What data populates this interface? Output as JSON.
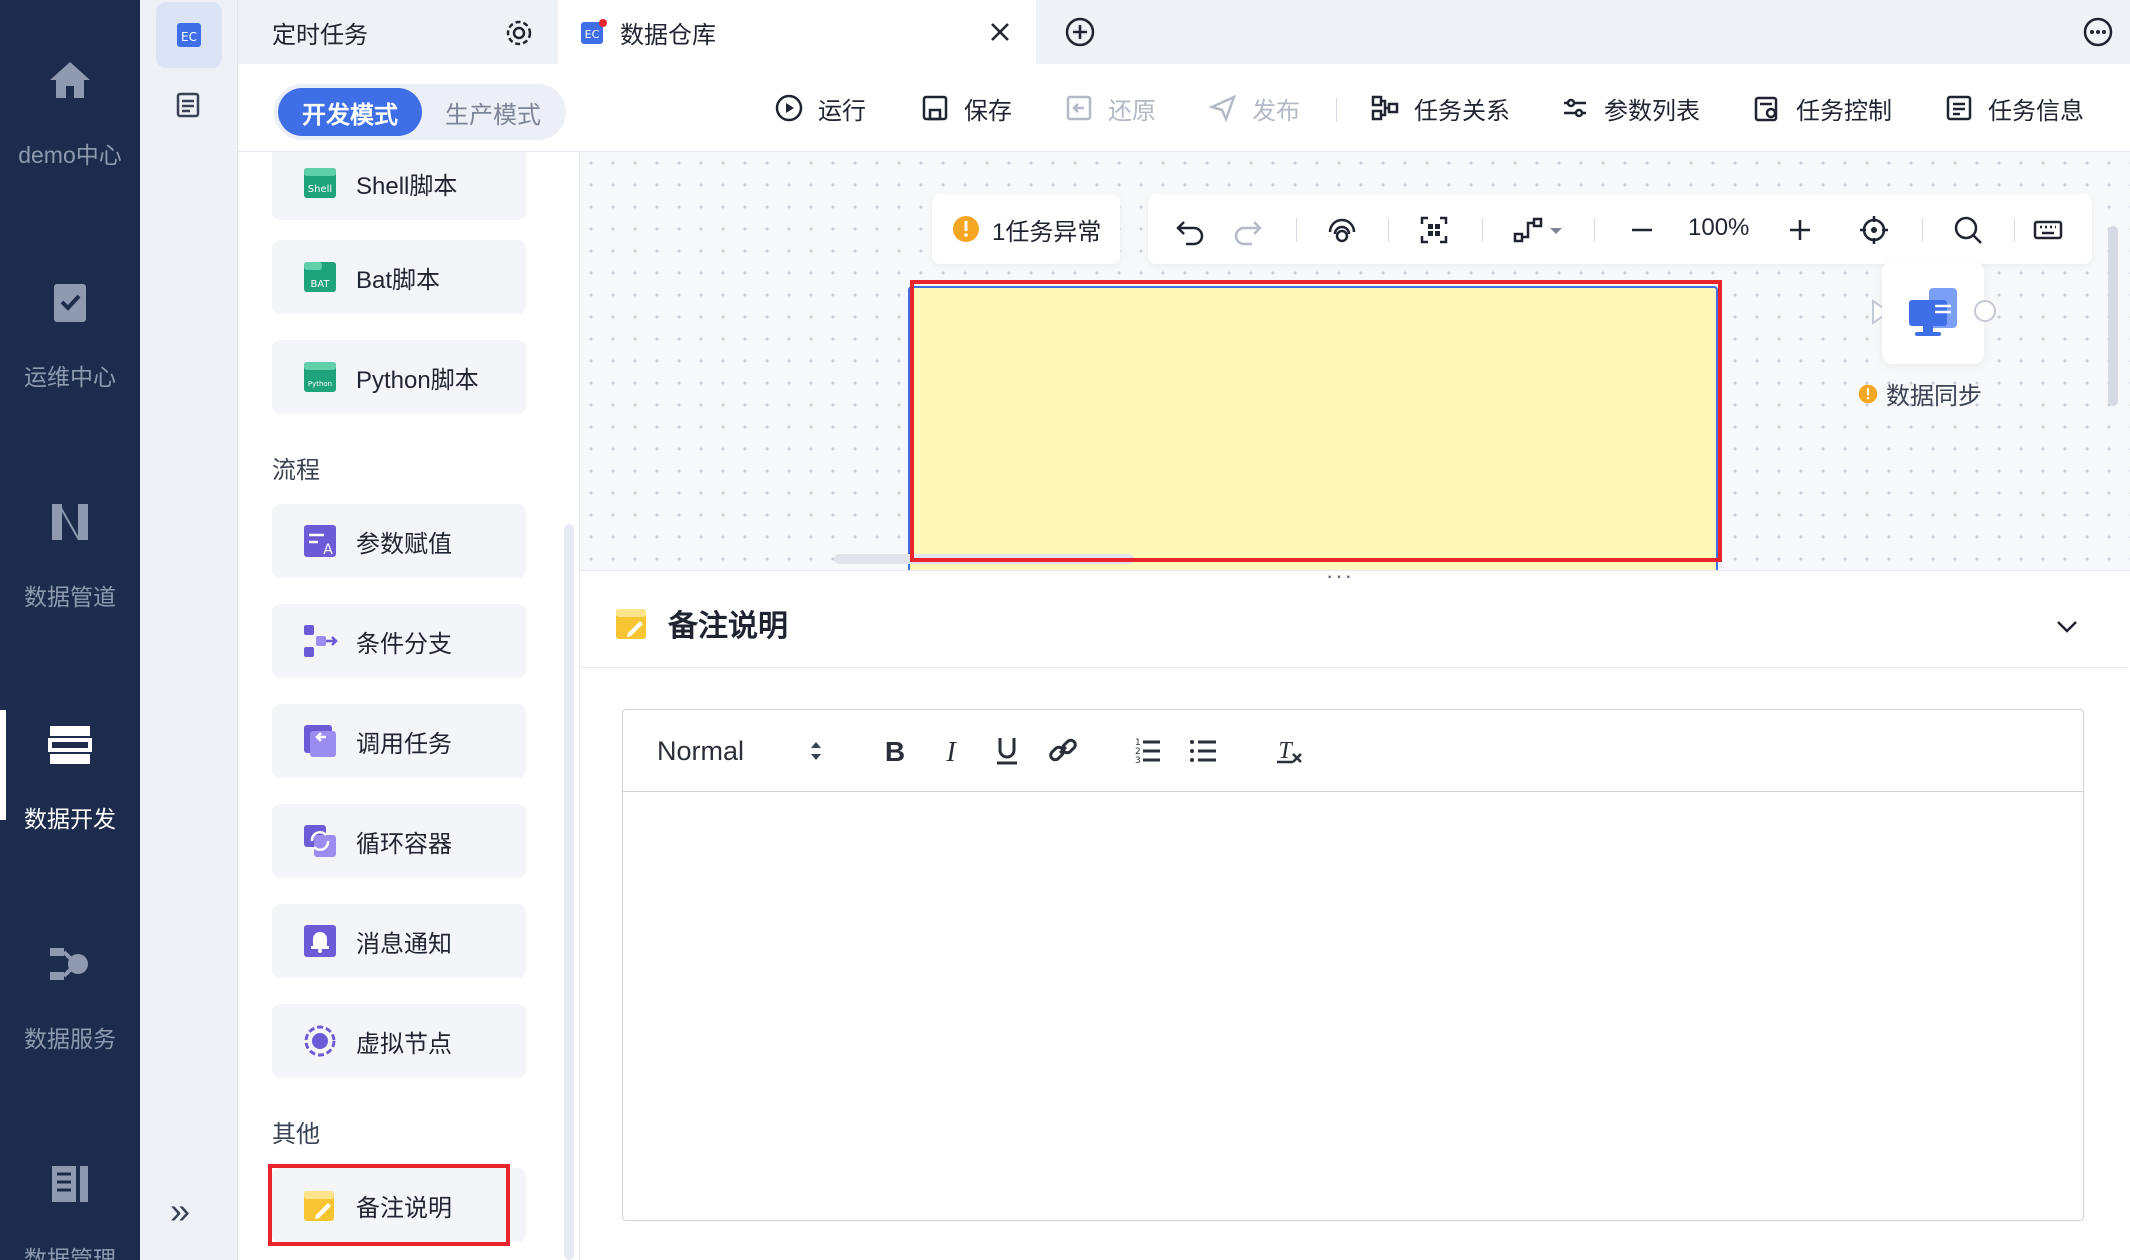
{
  "leftnav": {
    "items": [
      {
        "label": "demo中心",
        "icon": "home-icon"
      },
      {
        "label": "运维中心",
        "icon": "clipboard-check-icon"
      },
      {
        "label": "数据管道",
        "icon": "pipeline-icon"
      },
      {
        "label": "数据开发",
        "icon": "server-stack-icon",
        "active": true
      },
      {
        "label": "数据服务",
        "icon": "data-service-icon"
      },
      {
        "label": "数据管理",
        "icon": "data-manage-icon"
      }
    ]
  },
  "tabs": [
    {
      "label": "定时任务",
      "icon": "gear-icon"
    },
    {
      "label": "数据仓库",
      "active": true,
      "icon": "close-icon"
    }
  ],
  "toolbar": {
    "mode_dev": "开发模式",
    "mode_prod": "生产模式",
    "run": "运行",
    "save": "保存",
    "restore": "还原",
    "publish": "发布",
    "task_relation": "任务关系",
    "param_list": "参数列表",
    "task_control": "任务控制",
    "task_info": "任务信息"
  },
  "palette": {
    "scripts": [
      {
        "label": "Shell脚本",
        "icon": "shell-icon"
      },
      {
        "label": "Bat脚本",
        "icon": "bat-icon"
      },
      {
        "label": "Python脚本",
        "icon": "python-icon"
      }
    ],
    "flow_group": "流程",
    "flow": [
      {
        "label": "参数赋值",
        "icon": "param-assign-icon"
      },
      {
        "label": "条件分支",
        "icon": "branch-icon"
      },
      {
        "label": "调用任务",
        "icon": "call-task-icon"
      },
      {
        "label": "循环容器",
        "icon": "loop-icon"
      },
      {
        "label": "消息通知",
        "icon": "bell-icon"
      },
      {
        "label": "虚拟节点",
        "icon": "virtual-node-icon"
      }
    ],
    "other_group": "其他",
    "other": [
      {
        "label": "备注说明",
        "icon": "note-icon"
      }
    ]
  },
  "canvas": {
    "warning": "1任务异常",
    "zoom": "100%",
    "node_label": "数据同步"
  },
  "panel": {
    "title": "备注说明",
    "editor_format": "Normal"
  },
  "colors": {
    "primary": "#3f6fe6",
    "nav_bg": "#1d2c4d",
    "warning": "#f5a623",
    "highlight": "#e8242c",
    "note_bg": "#fff8b8"
  }
}
